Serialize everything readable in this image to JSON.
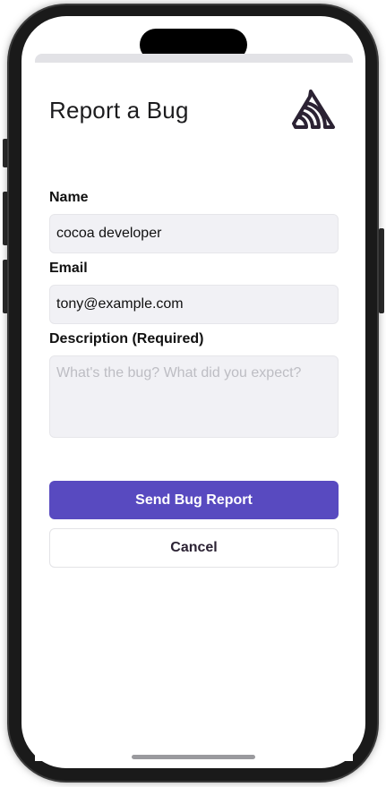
{
  "form": {
    "title": "Report a Bug",
    "logo_icon": "sentry-logo-icon",
    "name_label": "Name",
    "name_value": "cocoa developer",
    "email_label": "Email",
    "email_value": "tony@example.com",
    "description_label": "Description (Required)",
    "description_placeholder": "What's the bug? What did you expect?"
  },
  "actions": {
    "submit_label": "Send Bug Report",
    "cancel_label": "Cancel"
  },
  "colors": {
    "primary": "#584ac0",
    "field_bg": "#f1f1f5",
    "text": "#111111"
  }
}
